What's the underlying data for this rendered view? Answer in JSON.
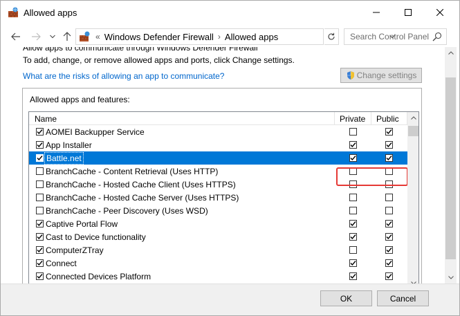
{
  "window": {
    "title": "Allowed apps"
  },
  "address": {
    "breadcrumbs": [
      "Windows Defender Firewall",
      "Allowed apps"
    ],
    "separator": "›",
    "prefix": "«"
  },
  "search": {
    "placeholder": "Search Control Panel"
  },
  "content": {
    "cut_text": "Allow apps to communicate through Windows Defender Firewall",
    "info": "To add, change, or remove allowed apps and ports, click Change settings.",
    "risk_link": "What are the risks of allowing an app to communicate?",
    "change_settings": "Change settings"
  },
  "list": {
    "group_label": "Allowed apps and features:",
    "columns": {
      "name": "Name",
      "private": "Private",
      "public": "Public"
    },
    "rows": [
      {
        "name": "AOMEI Backupper Service",
        "enabled": true,
        "private": false,
        "public": true,
        "selected": false
      },
      {
        "name": "App Installer",
        "enabled": true,
        "private": true,
        "public": true,
        "selected": false
      },
      {
        "name": "Battle.net",
        "enabled": true,
        "private": true,
        "public": true,
        "selected": true
      },
      {
        "name": "BranchCache - Content Retrieval (Uses HTTP)",
        "enabled": false,
        "private": false,
        "public": false,
        "selected": false
      },
      {
        "name": "BranchCache - Hosted Cache Client (Uses HTTPS)",
        "enabled": false,
        "private": false,
        "public": false,
        "selected": false
      },
      {
        "name": "BranchCache - Hosted Cache Server (Uses HTTPS)",
        "enabled": false,
        "private": false,
        "public": false,
        "selected": false
      },
      {
        "name": "BranchCache - Peer Discovery (Uses WSD)",
        "enabled": false,
        "private": false,
        "public": false,
        "selected": false
      },
      {
        "name": "Captive Portal Flow",
        "enabled": true,
        "private": true,
        "public": true,
        "selected": false
      },
      {
        "name": "Cast to Device functionality",
        "enabled": true,
        "private": true,
        "public": true,
        "selected": false
      },
      {
        "name": "ComputerZTray",
        "enabled": true,
        "private": false,
        "public": true,
        "selected": false
      },
      {
        "name": "Connect",
        "enabled": true,
        "private": true,
        "public": true,
        "selected": false
      },
      {
        "name": "Connected Devices Platform",
        "enabled": true,
        "private": true,
        "public": true,
        "selected": false
      }
    ]
  },
  "footer": {
    "ok": "OK",
    "cancel": "Cancel"
  },
  "colors": {
    "selection": "#0078d7",
    "link": "#0066cc",
    "highlight": "#e53935"
  }
}
